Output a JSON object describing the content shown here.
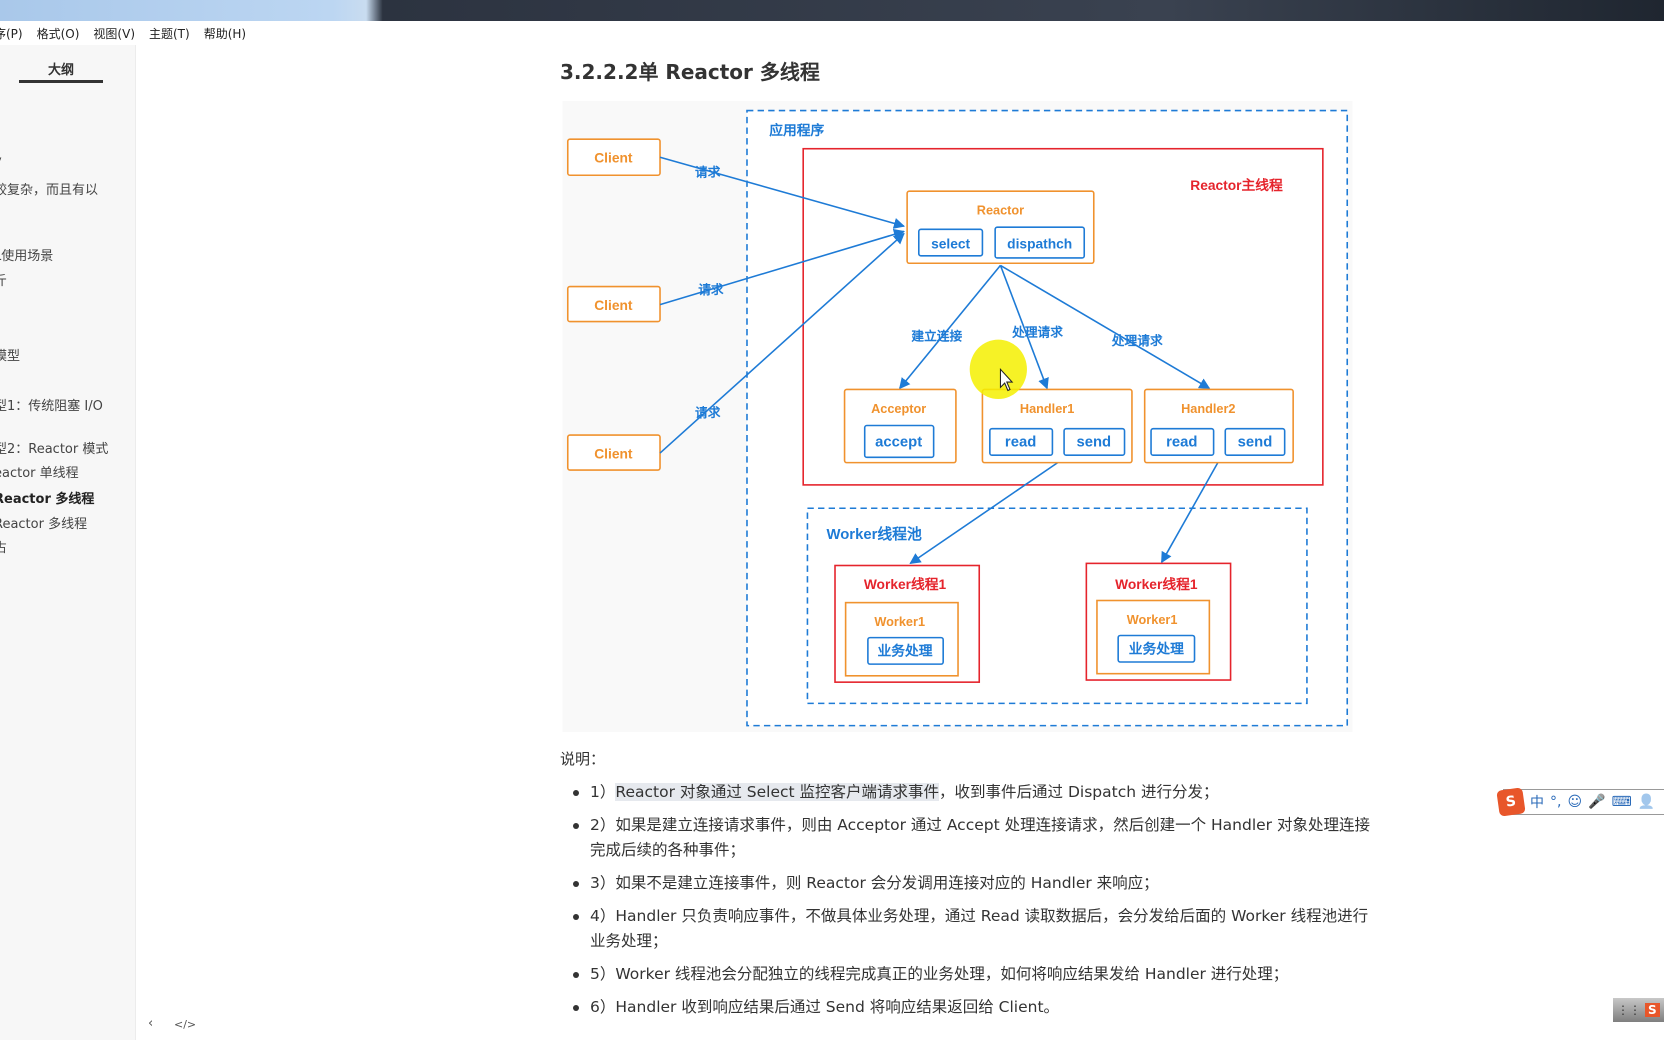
{
  "menu": [
    "序(P)",
    "格式(O)",
    "视图(V)",
    "主题(T)",
    "帮助(H)"
  ],
  "sidebar": {
    "tab": "大纲",
    "items": [
      {
        "label": "y",
        "active": false
      },
      {
        "label": "较复杂，而且有以",
        "active": false
      },
      {
        "label": ",",
        "active": false
      },
      {
        "label": "L使用场景",
        "active": false
      },
      {
        "label": "斤",
        "active": false
      },
      {
        "label": "模型",
        "active": false
      },
      {
        "label": "型1：传统阻塞 I/O",
        "active": false
      },
      {
        "label": "型2：Reactor 模式",
        "active": false
      },
      {
        "label": "eactor 单线程",
        "active": false
      },
      {
        "label": "Reactor 多线程",
        "active": true
      },
      {
        "label": " Reactor 多线程",
        "active": false
      },
      {
        "label": "占",
        "active": false
      }
    ],
    "footer_icons": [
      "chevron-left-icon",
      "code-icon"
    ],
    "footer_glyphs": [
      "‹",
      "</>"
    ]
  },
  "main": {
    "heading": "3.2.2.2单 Reactor 多线程",
    "diagram": {
      "app_label": "应用程序",
      "client": "Client",
      "request": "请求",
      "reactor_main": "Reactor主线程",
      "reactor": "Reactor",
      "select": "select",
      "dispatch": "dispathch",
      "connect": "建立连接",
      "handle_request": "处理请求",
      "acceptor": "Acceptor",
      "accept": "accept",
      "handler1": "Handler1",
      "handler2": "Handler2",
      "read": "read",
      "send": "send",
      "worker_pool": "Worker线程池",
      "worker_thread": "Worker线程1",
      "worker": "Worker1",
      "business": "业务处理",
      "colors": {
        "blue": "#1e7bd6",
        "orange": "#f0922e",
        "red": "#e5242c",
        "bg": "#f9f9f9"
      }
    },
    "note_label": "说明：",
    "points": [
      {
        "num": "1）",
        "highlight": "Reactor 对象通过 Select 监控客户端请求事件",
        "rest": "，收到事件后通过 Dispatch 进行分发；"
      },
      {
        "num": "2）",
        "highlight": "",
        "rest": "如果是建立连接请求事件，则由 Acceptor 通过 Accept 处理连接请求，然后创建一个 Handler 对象处理连接完成后续的各种事件；"
      },
      {
        "num": "3）",
        "highlight": "",
        "rest": "如果不是建立连接事件，则 Reactor 会分发调用连接对应的 Handler 来响应；"
      },
      {
        "num": "4）",
        "highlight": "",
        "rest": "Handler 只负责响应事件，不做具体业务处理，通过 Read 读取数据后，会分发给后面的 Worker 线程池进行业务处理；"
      },
      {
        "num": "5）",
        "highlight": "",
        "rest": "Worker 线程池会分配独立的线程完成真正的业务处理，如何将响应结果发给 Handler 进行处理；"
      },
      {
        "num": "6）",
        "highlight": "",
        "rest": "Handler 收到响应结果后通过 Send 将响应结果返回给 Client。"
      }
    ]
  },
  "ime": {
    "logo": "S",
    "items": [
      "中",
      "°,",
      "☺",
      "🎤",
      "⌨",
      "👤"
    ]
  },
  "tray": {
    "items": [
      "⋮⋮",
      "S",
      "?"
    ]
  }
}
